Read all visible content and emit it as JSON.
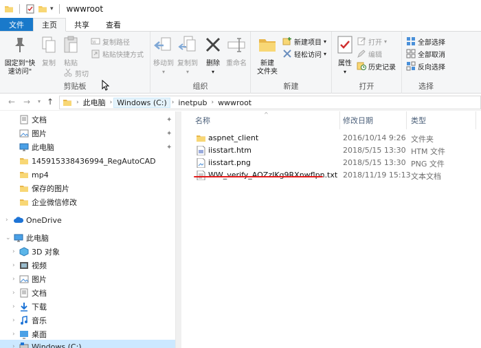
{
  "window": {
    "title": "wwwroot"
  },
  "tabs": [
    {
      "label": "文件"
    },
    {
      "label": "主页"
    },
    {
      "label": "共享"
    },
    {
      "label": "查看"
    }
  ],
  "ribbon": {
    "clipboard": {
      "pin_label": "固定到\"快\n速访问\"",
      "copy_label": "复制",
      "paste_label": "粘贴",
      "copy_path_label": "复制路径",
      "paste_shortcut_label": "粘贴快捷方式",
      "cut_label": "剪切",
      "group_label": "剪贴板"
    },
    "organize": {
      "move_to_label": "移动到",
      "copy_to_label": "复制到",
      "delete_label": "删除",
      "rename_label": "重命名",
      "group_label": "组织"
    },
    "new": {
      "new_folder_label": "新建\n文件夹",
      "new_item_label": "新建项目",
      "easy_access_label": "轻松访问",
      "group_label": "新建"
    },
    "open": {
      "properties_label": "属性",
      "open_label": "打开",
      "edit_label": "编辑",
      "history_label": "历史记录",
      "group_label": "打开"
    },
    "select": {
      "select_all_label": "全部选择",
      "select_none_label": "全部取消",
      "invert_label": "反向选择",
      "group_label": "选择"
    }
  },
  "address": {
    "crumbs": [
      "此电脑",
      "Windows (C:)",
      "inetpub",
      "wwwroot"
    ]
  },
  "nav": {
    "quick_access": [
      "文档",
      "图片",
      "此电脑",
      "145915338436994_RegAutoCAD",
      "mp4",
      "保存的图片",
      "企业微信修改"
    ],
    "onedrive": "OneDrive",
    "this_pc": "此电脑",
    "pc_items": [
      "3D 对象",
      "视频",
      "图片",
      "文档",
      "下载",
      "音乐",
      "桌面",
      "Windows (C:)"
    ]
  },
  "columns": {
    "name": "名称",
    "date": "修改日期",
    "type": "类型"
  },
  "files": [
    {
      "name": "aspnet_client",
      "date": "2016/10/14 9:26",
      "type": "文件夹",
      "icon": "folder-icon"
    },
    {
      "name": "iisstart.htm",
      "date": "2018/5/15 13:30",
      "type": "HTM 文件",
      "icon": "htm-file-icon"
    },
    {
      "name": "iisstart.png",
      "date": "2018/5/15 13:30",
      "type": "PNG 文件",
      "icon": "png-file-icon"
    },
    {
      "name": "WW_verify_AOZzIKg9RXnwflpn.txt",
      "date": "2018/11/19 15:13",
      "type": "文本文档",
      "icon": "txt-file-icon"
    }
  ],
  "colors": {
    "file_tab": "#1979ca",
    "selection": "#cce8ff",
    "underline": "#e41a1a",
    "folder": "#f8d775"
  }
}
